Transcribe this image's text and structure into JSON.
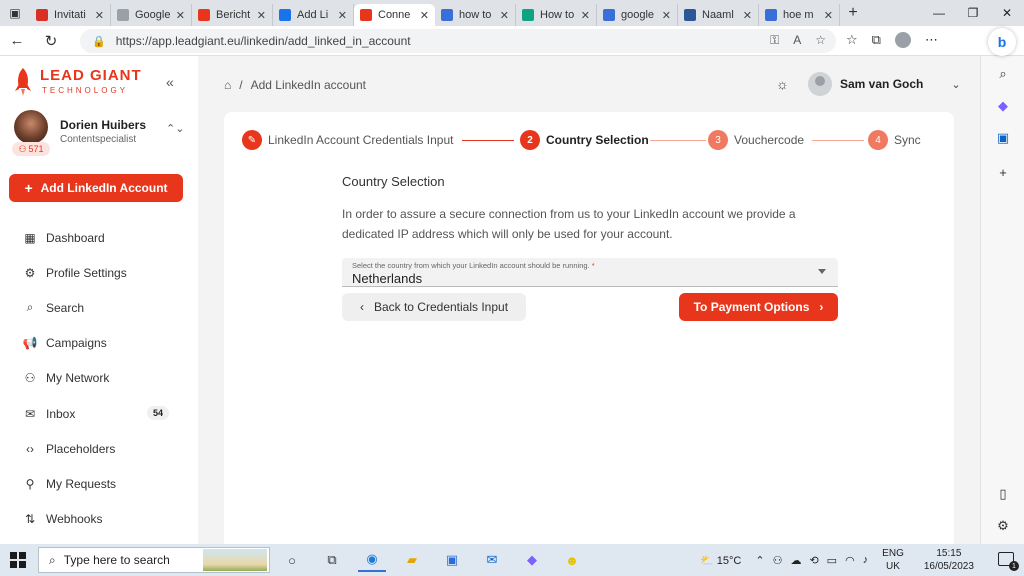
{
  "browser": {
    "tabs": [
      {
        "label": "Invitati",
        "color": "#d93025"
      },
      {
        "label": "Google",
        "color": "#9aa0a6"
      },
      {
        "label": "Bericht",
        "color": "#e8361d"
      },
      {
        "label": "Add Li",
        "color": "#1a73e8"
      },
      {
        "label": "Conne",
        "color": "#e8361d"
      },
      {
        "label": "how to",
        "color": "#3b6fd8"
      },
      {
        "label": "How to",
        "color": "#10a37f"
      },
      {
        "label": "google",
        "color": "#3b6fd8"
      },
      {
        "label": "Naaml",
        "color": "#2b5797"
      },
      {
        "label": "hoe m",
        "color": "#3b6fd8"
      }
    ],
    "url": "https://app.leadgiant.eu/linkedin/add_linked_in_account"
  },
  "sidebar": {
    "logo_main": "LEAD GIANT",
    "logo_sub": "TECHNOLOGY",
    "user_name": "Dorien Huibers",
    "user_role": "Contentspecialist",
    "user_badge": "571",
    "add_button": "Add LinkedIn Account",
    "items": [
      {
        "label": "Dashboard",
        "icon": "dashboard-icon"
      },
      {
        "label": "Profile Settings",
        "icon": "gear-icon"
      },
      {
        "label": "Search",
        "icon": "search-icon"
      },
      {
        "label": "Campaigns",
        "icon": "megaphone-icon"
      },
      {
        "label": "My Network",
        "icon": "people-icon"
      },
      {
        "label": "Inbox",
        "icon": "inbox-icon",
        "count": "54"
      },
      {
        "label": "Placeholders",
        "icon": "code-icon"
      },
      {
        "label": "My Requests",
        "icon": "user-plus-icon"
      },
      {
        "label": "Webhooks",
        "icon": "arrows-icon"
      }
    ]
  },
  "header": {
    "breadcrumb": "Add LinkedIn account",
    "user_name": "Sam van Goch"
  },
  "stepper": {
    "steps": [
      {
        "number": "",
        "label": "LinkedIn Account Credentials Input",
        "state": "done"
      },
      {
        "number": "2",
        "label": "Country Selection",
        "state": "current"
      },
      {
        "number": "3",
        "label": "Vouchercode",
        "state": "pending"
      },
      {
        "number": "4",
        "label": "Sync",
        "state": "pending"
      }
    ]
  },
  "form": {
    "title": "Country Selection",
    "description": "In order to assure a secure connection from us to your LinkedIn account we provide a dedicated IP address which will only be used for your account.",
    "select_label": "Select the country from which your LinkedIn account should be running.",
    "select_required": "*",
    "select_value": "Netherlands",
    "back_button": "Back to Credentials Input",
    "next_button": "To Payment Options"
  },
  "taskbar": {
    "search_placeholder": "Type here to search",
    "temperature": "15°C",
    "lang1": "ENG",
    "lang2": "UK",
    "time": "15:15",
    "date": "16/05/2023"
  },
  "colors": {
    "accent": "#e8361d"
  }
}
